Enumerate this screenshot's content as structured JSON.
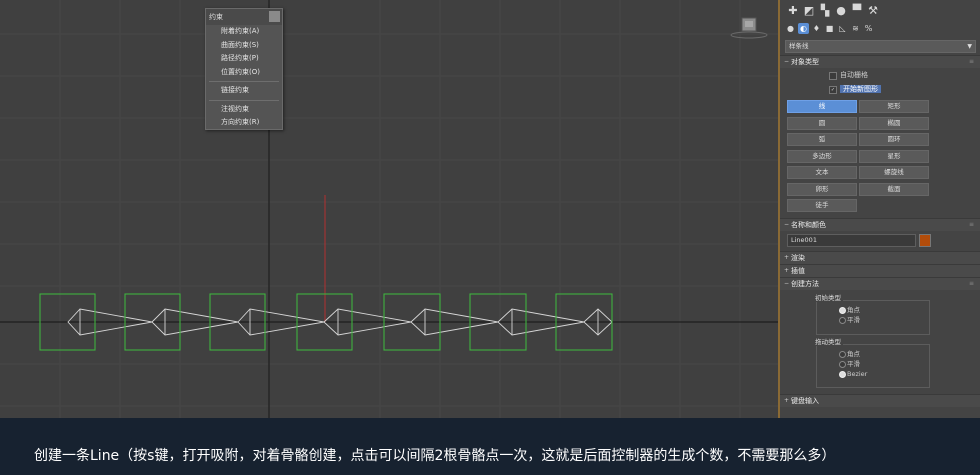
{
  "constraint_menu": {
    "title": "约束",
    "items": [
      "附着约束(A)",
      "曲面约束(S)",
      "路径约束(P)",
      "位置约束(O)",
      "链接约束",
      "注视约束",
      "方向约束(R)"
    ]
  },
  "command_panel": {
    "top_tab_icons": [
      "create-icon",
      "modify-icon",
      "hierarchy-icon",
      "motion-icon",
      "display-icon",
      "utilities-icon"
    ],
    "sub_tab_icons": [
      "geometry-icon",
      "shapes-icon",
      "lights-icon",
      "cameras-icon",
      "helpers-icon",
      "spacewarps-icon",
      "systems-icon"
    ],
    "category_dropdown": "样条线",
    "object_type": {
      "title": "对象类型",
      "auto_grid": "自动栅格",
      "start_new_shape": "开始新图形",
      "buttons": [
        "线",
        "矩形",
        "圆",
        "椭圆",
        "弧",
        "圆环",
        "多边形",
        "星形",
        "文本",
        "螺旋线",
        "卵形",
        "截面",
        "徒手"
      ],
      "active_button": "线"
    },
    "name_color": {
      "title": "名称和颜色",
      "name_value": "Line001",
      "swatch_color": "#b24c0a"
    },
    "rendering": "渲染",
    "interpolation": "插值",
    "creation_method": {
      "title": "创建方法",
      "initial_type_label": "初始类型",
      "initial_options": [
        "角点",
        "平滑"
      ],
      "initial_selected": "平滑",
      "drag_type_label": "拖动类型",
      "drag_options": [
        "角点",
        "平滑",
        "Bezier"
      ],
      "drag_selected": "Bezier"
    },
    "keyboard_entry": "键盘输入"
  },
  "caption": {
    "text": "创建一条Line（按s键，打开吸附，对着骨骼创建，点击可以间隔2根骨骼点一次，这就是后面控制器的生成个数，不需要那么多）"
  },
  "colors": {
    "viewport_bg": "#404040",
    "bone_box": "#3fb23f",
    "accent_blue": "#5b8fd6",
    "caption_bg": "#172230"
  }
}
